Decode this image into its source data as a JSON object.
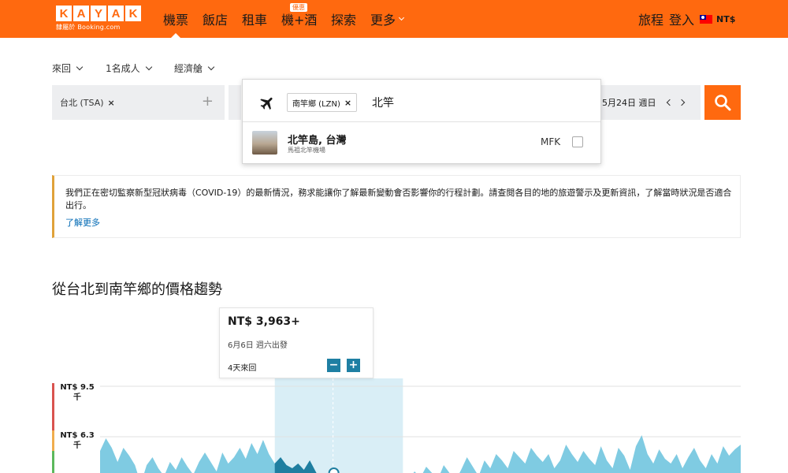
{
  "header": {
    "logo_letters": [
      "K",
      "A",
      "Y",
      "A",
      "K"
    ],
    "logo_sub": "隸屬於 Booking.com",
    "nav": [
      {
        "label": "機票",
        "active": true
      },
      {
        "label": "飯店"
      },
      {
        "label": "租車"
      },
      {
        "label": "機+酒",
        "badge": "優惠"
      },
      {
        "label": "探索"
      },
      {
        "label": "更多"
      }
    ],
    "trips": "旅程",
    "login": "登入",
    "currency": "NT$"
  },
  "options": {
    "trip_type": "來回",
    "travelers": "1名成人",
    "cabin": "經濟艙"
  },
  "search": {
    "origin": "台北 (TSA)",
    "destination_chip": "南竿鄉 (LZN)",
    "destination_query": "北竿",
    "date": "5月24日 週日"
  },
  "dropdown": {
    "result_name": "北竿島, 台灣",
    "result_sub": "馬祖北竿機場",
    "result_code": "MFK"
  },
  "alert": {
    "text": "我們正在密切監察新型冠狀病毒（COVID-19）的最新情況，務求能讓你了解最新變動會否影響你的行程計劃。請查閱各目的地的旅遊警示及更新資訊，了解當時狀況是否適合出行。",
    "link": "了解更多"
  },
  "chart_section": {
    "title": "從台北到南竿鄉的價格趨勢",
    "tooltip": {
      "price": "NT$ 3,963+",
      "date": "6月6日 週六出發",
      "duration": "4天來回",
      "minus": "−",
      "plus": "+"
    },
    "y_labels": [
      "NT$ 9.5\n千",
      "NT$ 6.3\n千"
    ]
  },
  "colors": {
    "brand": "#ff690f",
    "chart_fill": "#7fcbe2",
    "chart_highlight": "#1f7ea0",
    "highlight_band": "#d9eef6",
    "link": "#0069b4"
  },
  "chart_data": {
    "type": "area",
    "ylim": [
      0,
      9500
    ],
    "y_ticks": [
      9500,
      6300
    ],
    "y_tick_labels": [
      "NT$ 9.5千",
      "NT$ 6.3千"
    ],
    "highlight_range_index": [
      30,
      52
    ],
    "selected_index": 40,
    "values": [
      5400,
      6200,
      5600,
      4700,
      5600,
      5100,
      4500,
      3300,
      4500,
      5000,
      4300,
      3800,
      4700,
      4200,
      5000,
      4400,
      3900,
      4700,
      5300,
      4700,
      4100,
      5300,
      4600,
      5000,
      5600,
      4900,
      5900,
      5200,
      6100,
      5200,
      4600,
      5000,
      4500,
      4300,
      4600,
      4200,
      4800,
      4100,
      3400,
      3700,
      3100,
      3600,
      3300,
      3000,
      3300,
      2900,
      3500,
      3000,
      3300,
      2700,
      2500,
      3000,
      3200,
      3600,
      4100,
      3700,
      4400,
      4000,
      3600,
      4500,
      4000,
      3500,
      4200,
      5000,
      4400,
      3800,
      4800,
      4300,
      5200,
      4800,
      4300,
      5400,
      5000,
      4600,
      5600,
      5100,
      4700,
      5200,
      4300,
      4800,
      5800,
      5200,
      4700,
      5400,
      4900,
      4500,
      5700,
      4800,
      4300,
      5600,
      5100,
      4200,
      5700,
      6400,
      5200,
      4600,
      5500,
      4900,
      4600,
      5200,
      4300,
      5000,
      5600,
      4800,
      4300,
      5200,
      4600,
      5700,
      5100,
      5500,
      5800
    ]
  }
}
